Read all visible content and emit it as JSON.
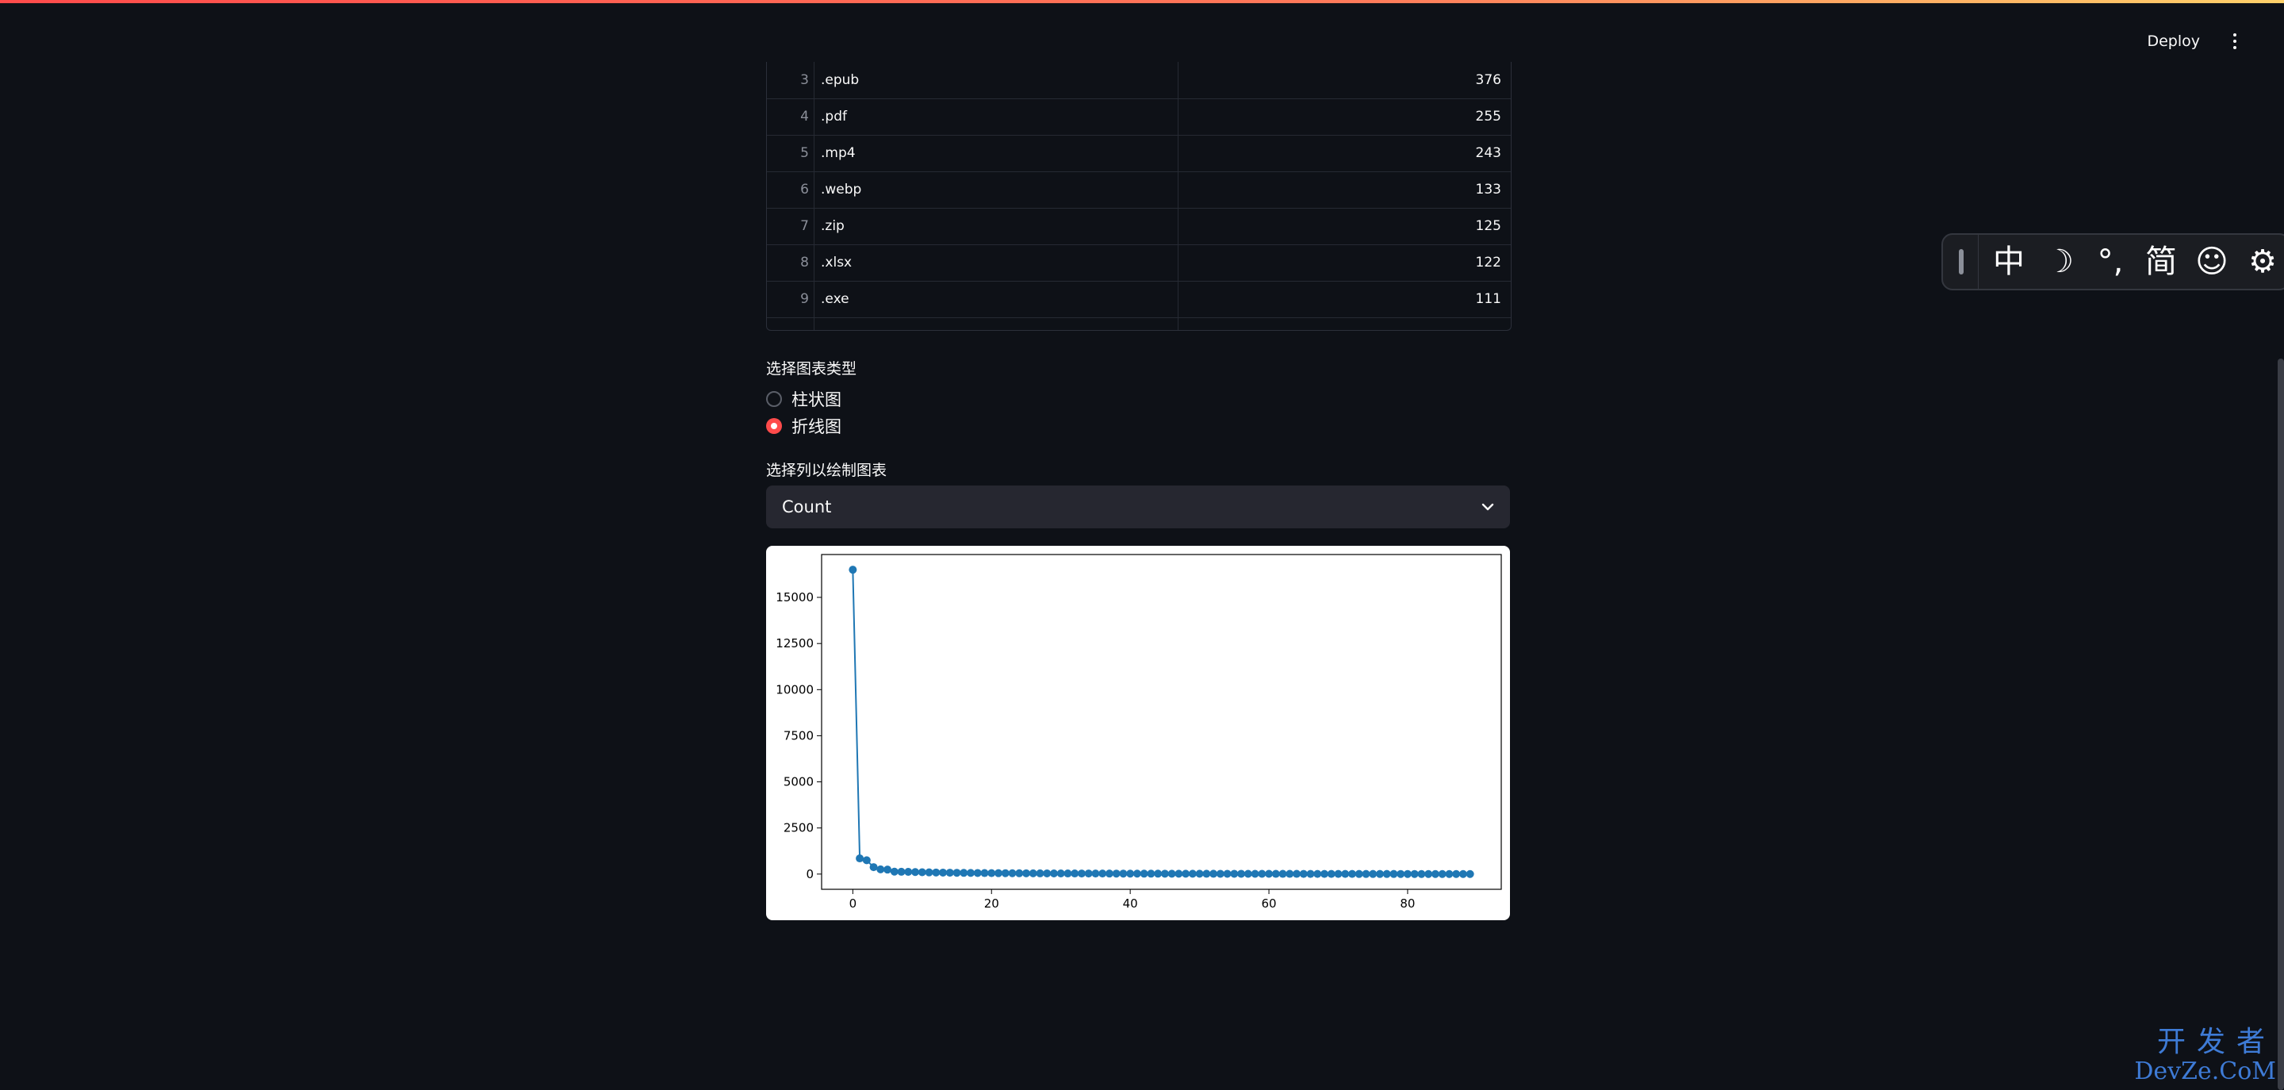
{
  "header": {
    "deploy_label": "Deploy",
    "menu_icon": "kebab-menu-icon"
  },
  "table": {
    "rows": [
      {
        "index": "3",
        "extension": ".epub",
        "count": "376"
      },
      {
        "index": "4",
        "extension": ".pdf",
        "count": "255"
      },
      {
        "index": "5",
        "extension": ".mp4",
        "count": "243"
      },
      {
        "index": "6",
        "extension": ".webp",
        "count": "133"
      },
      {
        "index": "7",
        "extension": ".zip",
        "count": "125"
      },
      {
        "index": "8",
        "extension": ".xlsx",
        "count": "122"
      },
      {
        "index": "9",
        "extension": ".exe",
        "count": "111"
      }
    ]
  },
  "chart_type_selector": {
    "label": "选择图表类型",
    "options": [
      {
        "label": "柱状图",
        "checked": false
      },
      {
        "label": "折线图",
        "checked": true
      }
    ]
  },
  "column_selector": {
    "label": "选择列以绘制图表",
    "value": "Count"
  },
  "chart_data": {
    "type": "line",
    "title": "",
    "xlabel": "",
    "ylabel": "",
    "xlim": [
      -4.5,
      93.5
    ],
    "ylim": [
      -825,
      17325
    ],
    "x_ticks": [
      0,
      20,
      40,
      60,
      80
    ],
    "y_ticks": [
      0,
      2500,
      5000,
      7500,
      10000,
      12500,
      15000
    ],
    "marker": "circle",
    "color": "#1f77b4",
    "grid": false,
    "series": [
      {
        "values": [
          16500,
          850,
          750,
          376,
          255,
          243,
          133,
          125,
          122,
          111,
          100,
          92,
          85,
          80,
          75,
          70,
          66,
          62,
          58,
          55,
          52,
          50,
          48,
          46,
          44,
          42,
          40,
          38,
          37,
          36,
          35,
          34,
          33,
          32,
          31,
          30,
          29,
          28,
          27,
          26,
          25,
          24,
          23,
          22,
          22,
          21,
          20,
          20,
          19,
          18,
          18,
          17,
          17,
          16,
          16,
          15,
          15,
          14,
          14,
          13,
          13,
          12,
          12,
          11,
          11,
          10,
          10,
          9,
          9,
          9,
          8,
          8,
          8,
          7,
          7,
          7,
          6,
          6,
          6,
          5,
          5,
          5,
          4,
          4,
          4,
          3,
          3,
          3,
          2,
          2
        ]
      }
    ]
  },
  "ime_toolbar": {
    "glyphs": [
      "中",
      "☽",
      "°,",
      "简",
      "☺",
      "⚙"
    ],
    "icons": [
      "ime-handle-icon",
      "chinese-mode-icon",
      "moon-icon",
      "punctuation-icon",
      "simplified-icon",
      "emoji-icon",
      "gear-icon"
    ]
  },
  "watermark": {
    "line1": "开发者",
    "line2": "DevZe.CoM"
  },
  "colors": {
    "background": "#0e1117",
    "accent": "#ff4b4b",
    "select_bg": "#262730",
    "line": "#1f77b4",
    "watermark": "#3e7bd6"
  }
}
